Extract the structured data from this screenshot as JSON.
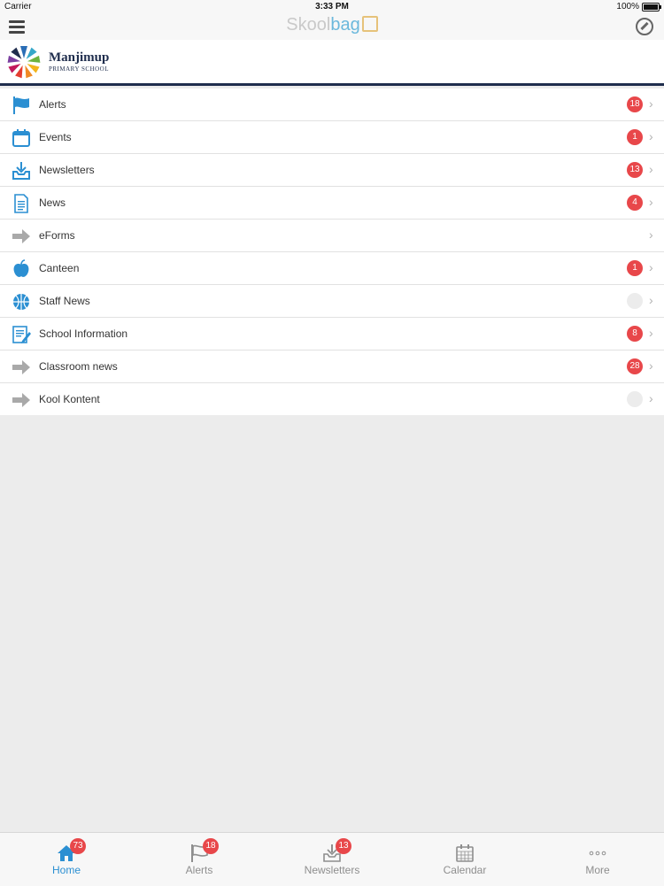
{
  "status_bar": {
    "carrier": "Carrier",
    "time": "3:33 PM",
    "battery": "100%"
  },
  "nav": {
    "brand_a": "Skool",
    "brand_b": "bag"
  },
  "school": {
    "name": "Manjimup",
    "subtitle": "PRIMARY SCHOOL"
  },
  "menu": [
    {
      "label": "Alerts",
      "badge": "18",
      "icon": "flag-icon"
    },
    {
      "label": "Events",
      "badge": "1",
      "icon": "calendar-icon"
    },
    {
      "label": "Newsletters",
      "badge": "13",
      "icon": "inbox-download-icon"
    },
    {
      "label": "News",
      "badge": "4",
      "icon": "document-icon"
    },
    {
      "label": "eForms",
      "badge": "",
      "icon": "arrow-right-icon"
    },
    {
      "label": "Canteen",
      "badge": "1",
      "icon": "apple-icon"
    },
    {
      "label": "Staff News",
      "badge": "",
      "icon": "basketball-icon"
    },
    {
      "label": "School Information",
      "badge": "8",
      "icon": "notepad-icon"
    },
    {
      "label": "Classroom news",
      "badge": "28",
      "icon": "arrow-right-icon"
    },
    {
      "label": "Kool Kontent",
      "badge": "",
      "icon": "arrow-right-icon"
    }
  ],
  "tabs": [
    {
      "label": "Home",
      "badge": "73"
    },
    {
      "label": "Alerts",
      "badge": "18"
    },
    {
      "label": "Newsletters",
      "badge": "13"
    },
    {
      "label": "Calendar",
      "badge": ""
    },
    {
      "label": "More",
      "badge": ""
    }
  ],
  "colors": {
    "accent": "#2b8fd2",
    "badge": "#e8474a",
    "header_rule": "#1f2d4d"
  }
}
